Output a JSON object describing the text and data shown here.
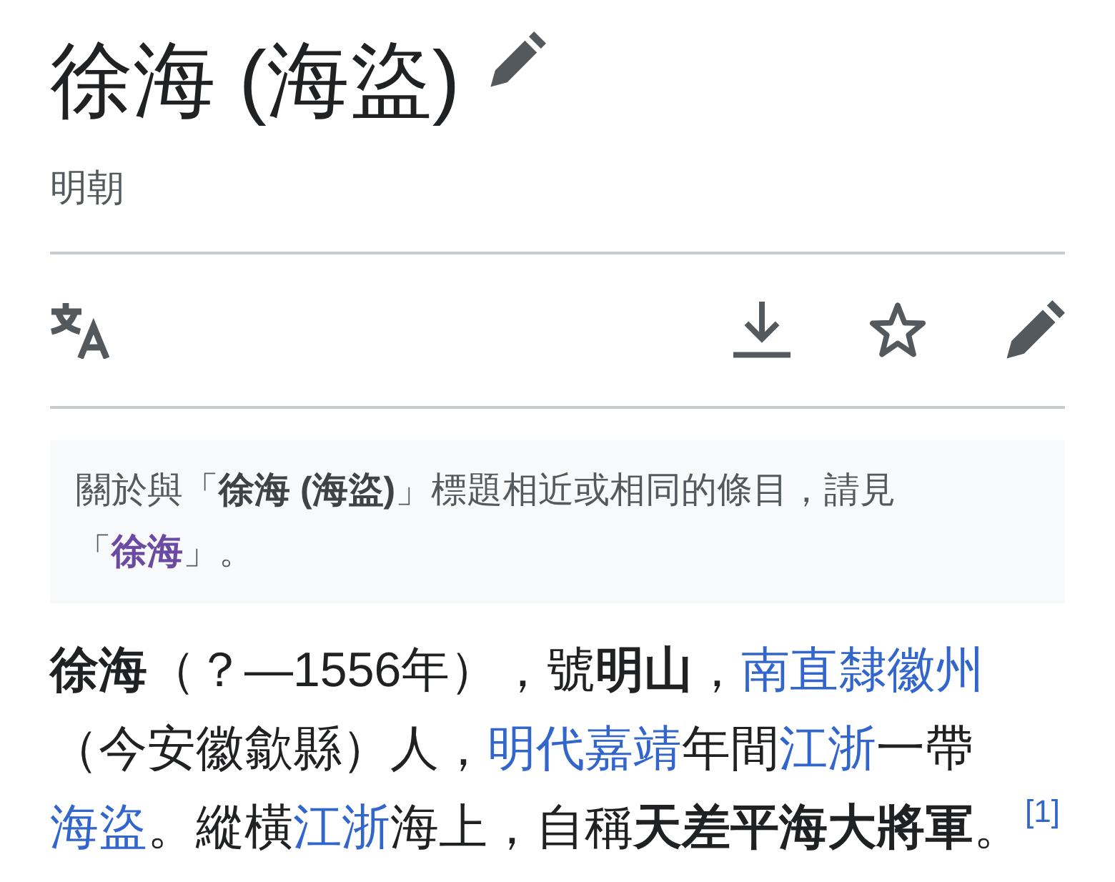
{
  "header": {
    "title": "徐海 (海盜)",
    "subtitle": "明朝"
  },
  "hatnote": {
    "segments": [
      {
        "kind": "text",
        "text": "關於與「**徐海 (海盜)**」標題相近或相同的條目，請見「"
      },
      {
        "kind": "link",
        "text": "徐海",
        "visited": true
      },
      {
        "kind": "text",
        "text": "」。"
      }
    ]
  },
  "paragraph": {
    "segments": [
      {
        "kind": "text",
        "text": "**徐海**（？—1556年），號**明山**，"
      },
      {
        "kind": "link",
        "text": "南直隸徽州",
        "visited": false
      },
      {
        "kind": "text",
        "text": "（今安徽歙縣）人，"
      },
      {
        "kind": "link",
        "text": "明代嘉靖",
        "visited": false
      },
      {
        "kind": "text",
        "text": "年間"
      },
      {
        "kind": "link",
        "text": "江浙",
        "visited": false
      },
      {
        "kind": "text",
        "text": "一帶"
      },
      {
        "kind": "link",
        "text": "海盜",
        "visited": false
      },
      {
        "kind": "text",
        "text": "。縱橫"
      },
      {
        "kind": "link",
        "text": "江浙",
        "visited": false
      },
      {
        "kind": "text",
        "text": "海上，自稱**天差平海大將軍**。"
      },
      {
        "kind": "ref",
        "text": "[1]",
        "visited": false
      }
    ]
  }
}
